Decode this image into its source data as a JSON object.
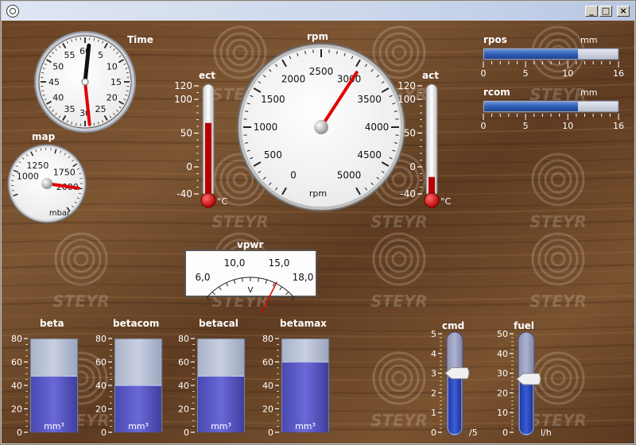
{
  "window": {
    "title": "",
    "buttons": [
      "minimize",
      "maximize",
      "close"
    ]
  },
  "brand": "STEYR",
  "gauges": {
    "time": {
      "label": "Time",
      "ticks": [
        "60",
        "5",
        "10",
        "15",
        "20",
        "25",
        "30",
        "35",
        "40",
        "45",
        "50",
        "55"
      ],
      "hand_short": 61,
      "hand_long": 29
    },
    "map": {
      "label": "map",
      "ticks": [
        "1000",
        "1250",
        "1750",
        "2000"
      ],
      "unit": "mbar",
      "value": 2000
    },
    "rpm": {
      "label": "rpm",
      "ticks": [
        "0",
        "500",
        "1000",
        "1500",
        "2000",
        "2500",
        "3000",
        "3500",
        "4000",
        "4500",
        "5000"
      ],
      "unit": "rpm",
      "value": 3050
    },
    "vpwr": {
      "label": "vpwr",
      "ticks": [
        "6,0",
        "10,0",
        "15,0",
        "18,0"
      ],
      "unit": "V",
      "value": 15.2
    }
  },
  "thermometers": {
    "ect": {
      "label": "ect",
      "ticks": [
        "120",
        "100",
        "50",
        "0",
        "-40"
      ],
      "unit": "°C",
      "value": 65
    },
    "act": {
      "label": "act",
      "ticks": [
        "120",
        "100",
        "50",
        "0",
        "-40"
      ],
      "unit": "°C",
      "value": -15
    }
  },
  "bars": {
    "rpos": {
      "label": "rpos",
      "unit": "mm",
      "ticks": [
        "0",
        "5",
        "10",
        "16"
      ],
      "value": 11.2
    },
    "rcom": {
      "label": "rcom",
      "unit": "mm",
      "ticks": [
        "0",
        "5",
        "10",
        "16"
      ],
      "value": 11.2
    }
  },
  "tanks": {
    "ticks": [
      "80",
      "60",
      "40",
      "20",
      "0"
    ],
    "unit": "mm³",
    "items": [
      {
        "label": "beta",
        "value": 48
      },
      {
        "label": "betacom",
        "value": 40
      },
      {
        "label": "betacal",
        "value": 48
      },
      {
        "label": "betamax",
        "value": 60
      }
    ]
  },
  "sliders": {
    "cmd": {
      "label": "cmd",
      "ticks": [
        "5",
        "4",
        "3",
        "2",
        "1",
        "0"
      ],
      "unit": "/5",
      "value": 3.0
    },
    "fuel": {
      "label": "fuel",
      "ticks": [
        "50",
        "40",
        "30",
        "20",
        "10",
        "0"
      ],
      "unit": "l/h",
      "value": 27
    }
  },
  "colors": {
    "needle": "#e00000",
    "bar_fill": "#2e5fb5",
    "tank_fill": "#5856c6",
    "slider_fill": "#2f4fc0"
  }
}
